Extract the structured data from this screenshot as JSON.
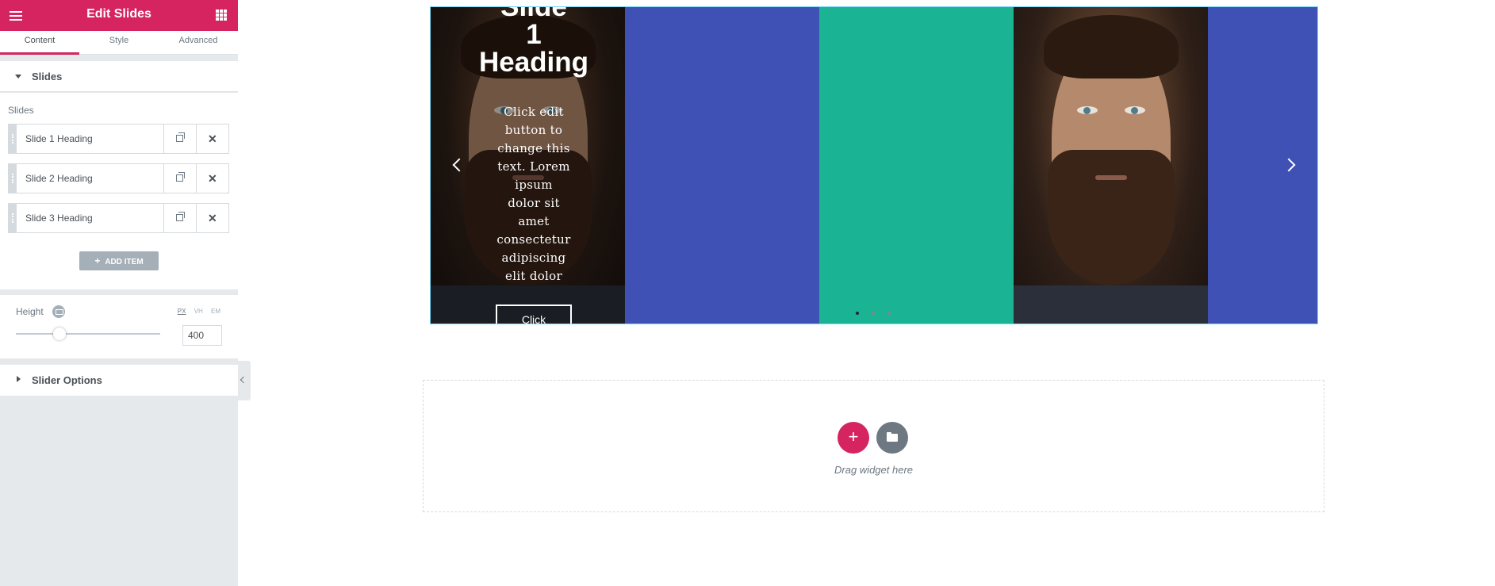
{
  "panel": {
    "title": "Edit Slides",
    "tabs": [
      "Content",
      "Style",
      "Advanced"
    ],
    "active_tab": "Content",
    "accent_color": "#d5245f"
  },
  "slides_section": {
    "title": "Slides",
    "control_label": "Slides",
    "items": [
      {
        "title": "Slide 1 Heading"
      },
      {
        "title": "Slide 2 Heading"
      },
      {
        "title": "Slide 3 Heading"
      }
    ],
    "add_item_label": "ADD ITEM",
    "height": {
      "label": "Height",
      "units": [
        "PX",
        "VH",
        "EM"
      ],
      "active_unit": "PX",
      "value": "400",
      "slider_fraction": 0.3
    }
  },
  "slider_options_section": {
    "title": "Slider Options"
  },
  "preview": {
    "slides": [
      {
        "background": "image",
        "overlay": true
      },
      {
        "background": "#3f51b5"
      },
      {
        "background": "#1ab394"
      },
      {
        "background": "image"
      },
      {
        "background": "#3f51b5"
      }
    ],
    "first_slide": {
      "heading_lines": [
        "Slide",
        "1",
        "Heading"
      ],
      "description_lines": [
        "Click edit",
        "button to",
        "change this",
        "text. Lorem",
        "ipsum",
        "dolor sit",
        "amet",
        "consectetur",
        "adipiscing",
        "elit dolor"
      ],
      "button_label": "Click"
    },
    "dots_count": 3,
    "active_dot": 0
  },
  "dropzone": {
    "text": "Drag widget here",
    "add_icon": "plus-icon",
    "template_icon": "folder-icon"
  }
}
